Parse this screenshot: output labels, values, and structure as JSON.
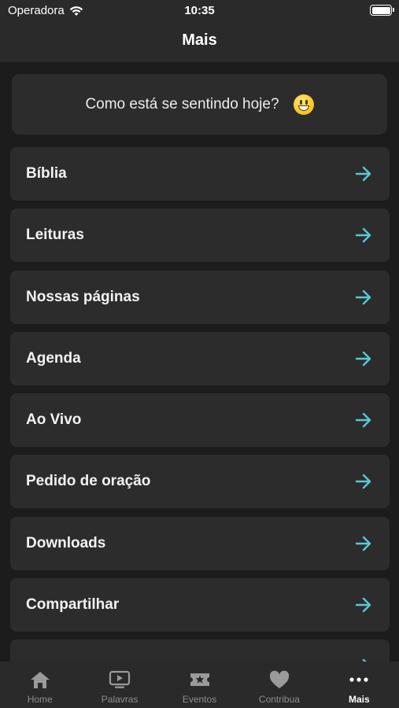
{
  "status_bar": {
    "carrier": "Operadora",
    "time": "10:35"
  },
  "nav": {
    "title": "Mais"
  },
  "mood": {
    "prompt": "Como está se sentindo hoje?",
    "emoji": "grinning-face-icon"
  },
  "menu": {
    "accent": "#5bc8d6",
    "items": [
      {
        "label": "Bíblia"
      },
      {
        "label": "Leituras"
      },
      {
        "label": "Nossas páginas"
      },
      {
        "label": "Agenda"
      },
      {
        "label": "Ao Vivo"
      },
      {
        "label": "Pedido de oração"
      },
      {
        "label": "Downloads"
      },
      {
        "label": "Compartilhar"
      },
      {
        "label": ""
      }
    ]
  },
  "tabbar": {
    "tabs": [
      {
        "label": "Home",
        "icon": "home-icon",
        "active": false
      },
      {
        "label": "Palavras",
        "icon": "video-icon",
        "active": false
      },
      {
        "label": "Eventos",
        "icon": "ticket-star-icon",
        "active": false
      },
      {
        "label": "Contribua",
        "icon": "heart-icon",
        "active": false
      },
      {
        "label": "Mais",
        "icon": "more-dots-icon",
        "active": true
      }
    ]
  }
}
